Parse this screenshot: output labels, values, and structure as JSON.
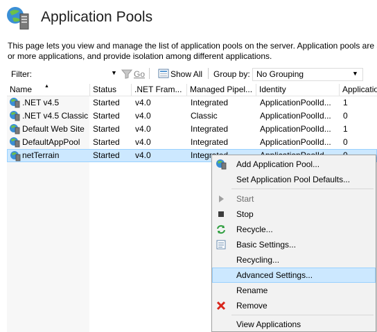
{
  "header": {
    "title": "Application Pools",
    "description_line1": "This page lets you view and manage the list of application pools on the server. Application pools are a",
    "description_line2": "or more applications, and provide isolation among different applications."
  },
  "filter_bar": {
    "filter_label": "Filter:",
    "go_label": "Go",
    "show_all_label": "Show All",
    "group_by_label": "Group by:",
    "grouping_value": "No Grouping"
  },
  "table": {
    "columns": [
      "Name",
      "Status",
      ".NET Fram...",
      "Managed Pipel...",
      "Identity",
      "Applicatio"
    ],
    "rows": [
      {
        "name": ".NET v4.5",
        "status": "Started",
        "net": "v4.0",
        "pipeline": "Integrated",
        "identity": "ApplicationPoolId...",
        "apps": "1"
      },
      {
        "name": ".NET v4.5 Classic",
        "status": "Started",
        "net": "v4.0",
        "pipeline": "Classic",
        "identity": "ApplicationPoolId...",
        "apps": "0"
      },
      {
        "name": "Default Web Site",
        "status": "Started",
        "net": "v4.0",
        "pipeline": "Integrated",
        "identity": "ApplicationPoolId...",
        "apps": "1"
      },
      {
        "name": "DefaultAppPool",
        "status": "Started",
        "net": "v4.0",
        "pipeline": "Integrated",
        "identity": "ApplicationPoolId...",
        "apps": "0"
      },
      {
        "name": "netTerrain",
        "status": "Started",
        "net": "v4.0",
        "pipeline": "Integrated",
        "identity": "ApplicationPoolId...",
        "apps": "0"
      }
    ]
  },
  "context_menu": {
    "items": [
      {
        "label": "Add Application Pool...",
        "icon": "app-pool-add-icon"
      },
      {
        "label": "Set Application Pool Defaults...",
        "icon": ""
      },
      {
        "label": "Start",
        "icon": "start-icon",
        "disabled": true
      },
      {
        "label": "Stop",
        "icon": "stop-icon"
      },
      {
        "label": "Recycle...",
        "icon": "recycle-icon"
      },
      {
        "label": "Basic Settings...",
        "icon": "basic-settings-icon"
      },
      {
        "label": "Recycling...",
        "icon": ""
      },
      {
        "label": "Advanced Settings...",
        "icon": "",
        "highlighted": true
      },
      {
        "label": "Rename",
        "icon": ""
      },
      {
        "label": "Remove",
        "icon": "remove-icon"
      },
      {
        "label": "View Applications",
        "icon": ""
      }
    ]
  },
  "colors": {
    "selection": "#cce8ff",
    "selection_border": "#99d1ff",
    "menu_bg": "#f2f2f2",
    "remove_red": "#d9261c",
    "recycle_green": "#2e9e3e"
  }
}
